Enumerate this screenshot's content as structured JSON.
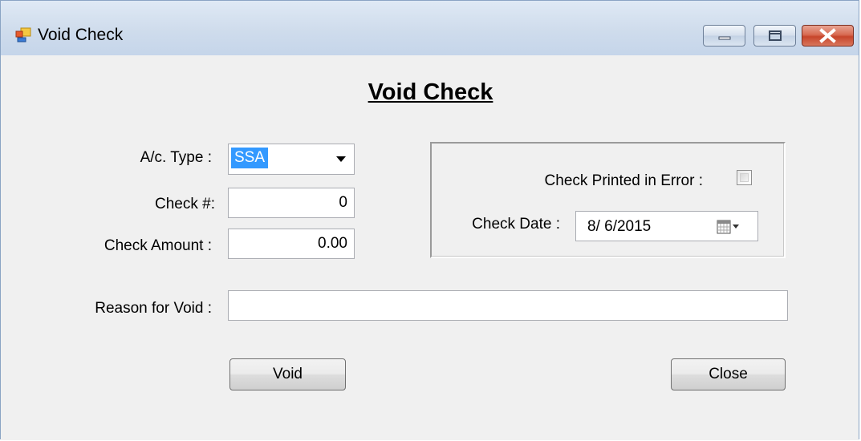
{
  "window": {
    "title": "Void Check",
    "icons": {
      "app": "app-form-icon",
      "minimize": "minimize-icon",
      "maximize": "maximize-icon",
      "close": "close-icon"
    }
  },
  "form": {
    "heading": "Void Check",
    "account_type": {
      "label": "A/c. Type :",
      "value": "SSA"
    },
    "check_number": {
      "label": "Check #:",
      "value": "0"
    },
    "check_amount": {
      "label": "Check Amount :",
      "value": "0.00"
    },
    "reason": {
      "label": "Reason for Void :",
      "value": ""
    },
    "printed_in_error": {
      "label": "Check Printed in Error :",
      "checked": false
    },
    "check_date": {
      "label": "Check Date :",
      "value": "8/  6/2015",
      "icon": "calendar-dropdown-icon"
    }
  },
  "buttons": {
    "void": "Void",
    "close": "Close"
  }
}
